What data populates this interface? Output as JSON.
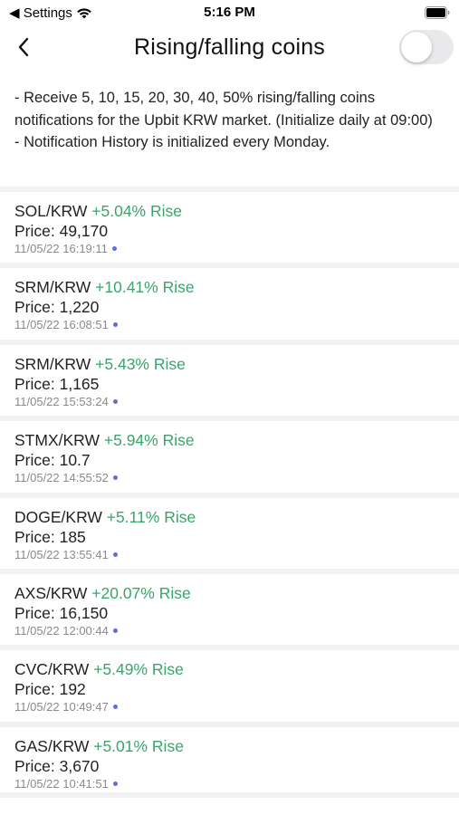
{
  "status_bar": {
    "back_label": "◀ Settings",
    "time": "5:16 PM"
  },
  "header": {
    "title": "Rising/falling coins",
    "toggle_on": false
  },
  "description": {
    "line1": "- Receive 5, 10, 15, 20, 30, 40, 50% rising/falling coins notifications for the Upbit KRW market. (Initialize daily at 09:00)",
    "line2": "- Notification History is initialized every Monday."
  },
  "colors": {
    "rise": "#3aa56b",
    "unread_dot": "#5b6ee1",
    "separator": "#f2f2f4"
  },
  "notifications": [
    {
      "pair": "SOL/KRW",
      "change": "+5.04% Rise",
      "price": "Price: 49,170",
      "time": "11/05/22 16:19:11"
    },
    {
      "pair": "SRM/KRW",
      "change": "+10.41% Rise",
      "price": "Price: 1,220",
      "time": "11/05/22 16:08:51"
    },
    {
      "pair": "SRM/KRW",
      "change": "+5.43% Rise",
      "price": "Price: 1,165",
      "time": "11/05/22 15:53:24"
    },
    {
      "pair": "STMX/KRW",
      "change": "+5.94% Rise",
      "price": "Price: 10.7",
      "time": "11/05/22 14:55:52"
    },
    {
      "pair": "DOGE/KRW",
      "change": "+5.11% Rise",
      "price": "Price: 185",
      "time": "11/05/22 13:55:41"
    },
    {
      "pair": "AXS/KRW",
      "change": "+20.07% Rise",
      "price": "Price: 16,150",
      "time": "11/05/22 12:00:44"
    },
    {
      "pair": "CVC/KRW",
      "change": "+5.49% Rise",
      "price": "Price: 192",
      "time": "11/05/22 10:49:47"
    },
    {
      "pair": "GAS/KRW",
      "change": "+5.01% Rise",
      "price": "Price: 3,670",
      "time": "11/05/22 10:41:51"
    }
  ]
}
